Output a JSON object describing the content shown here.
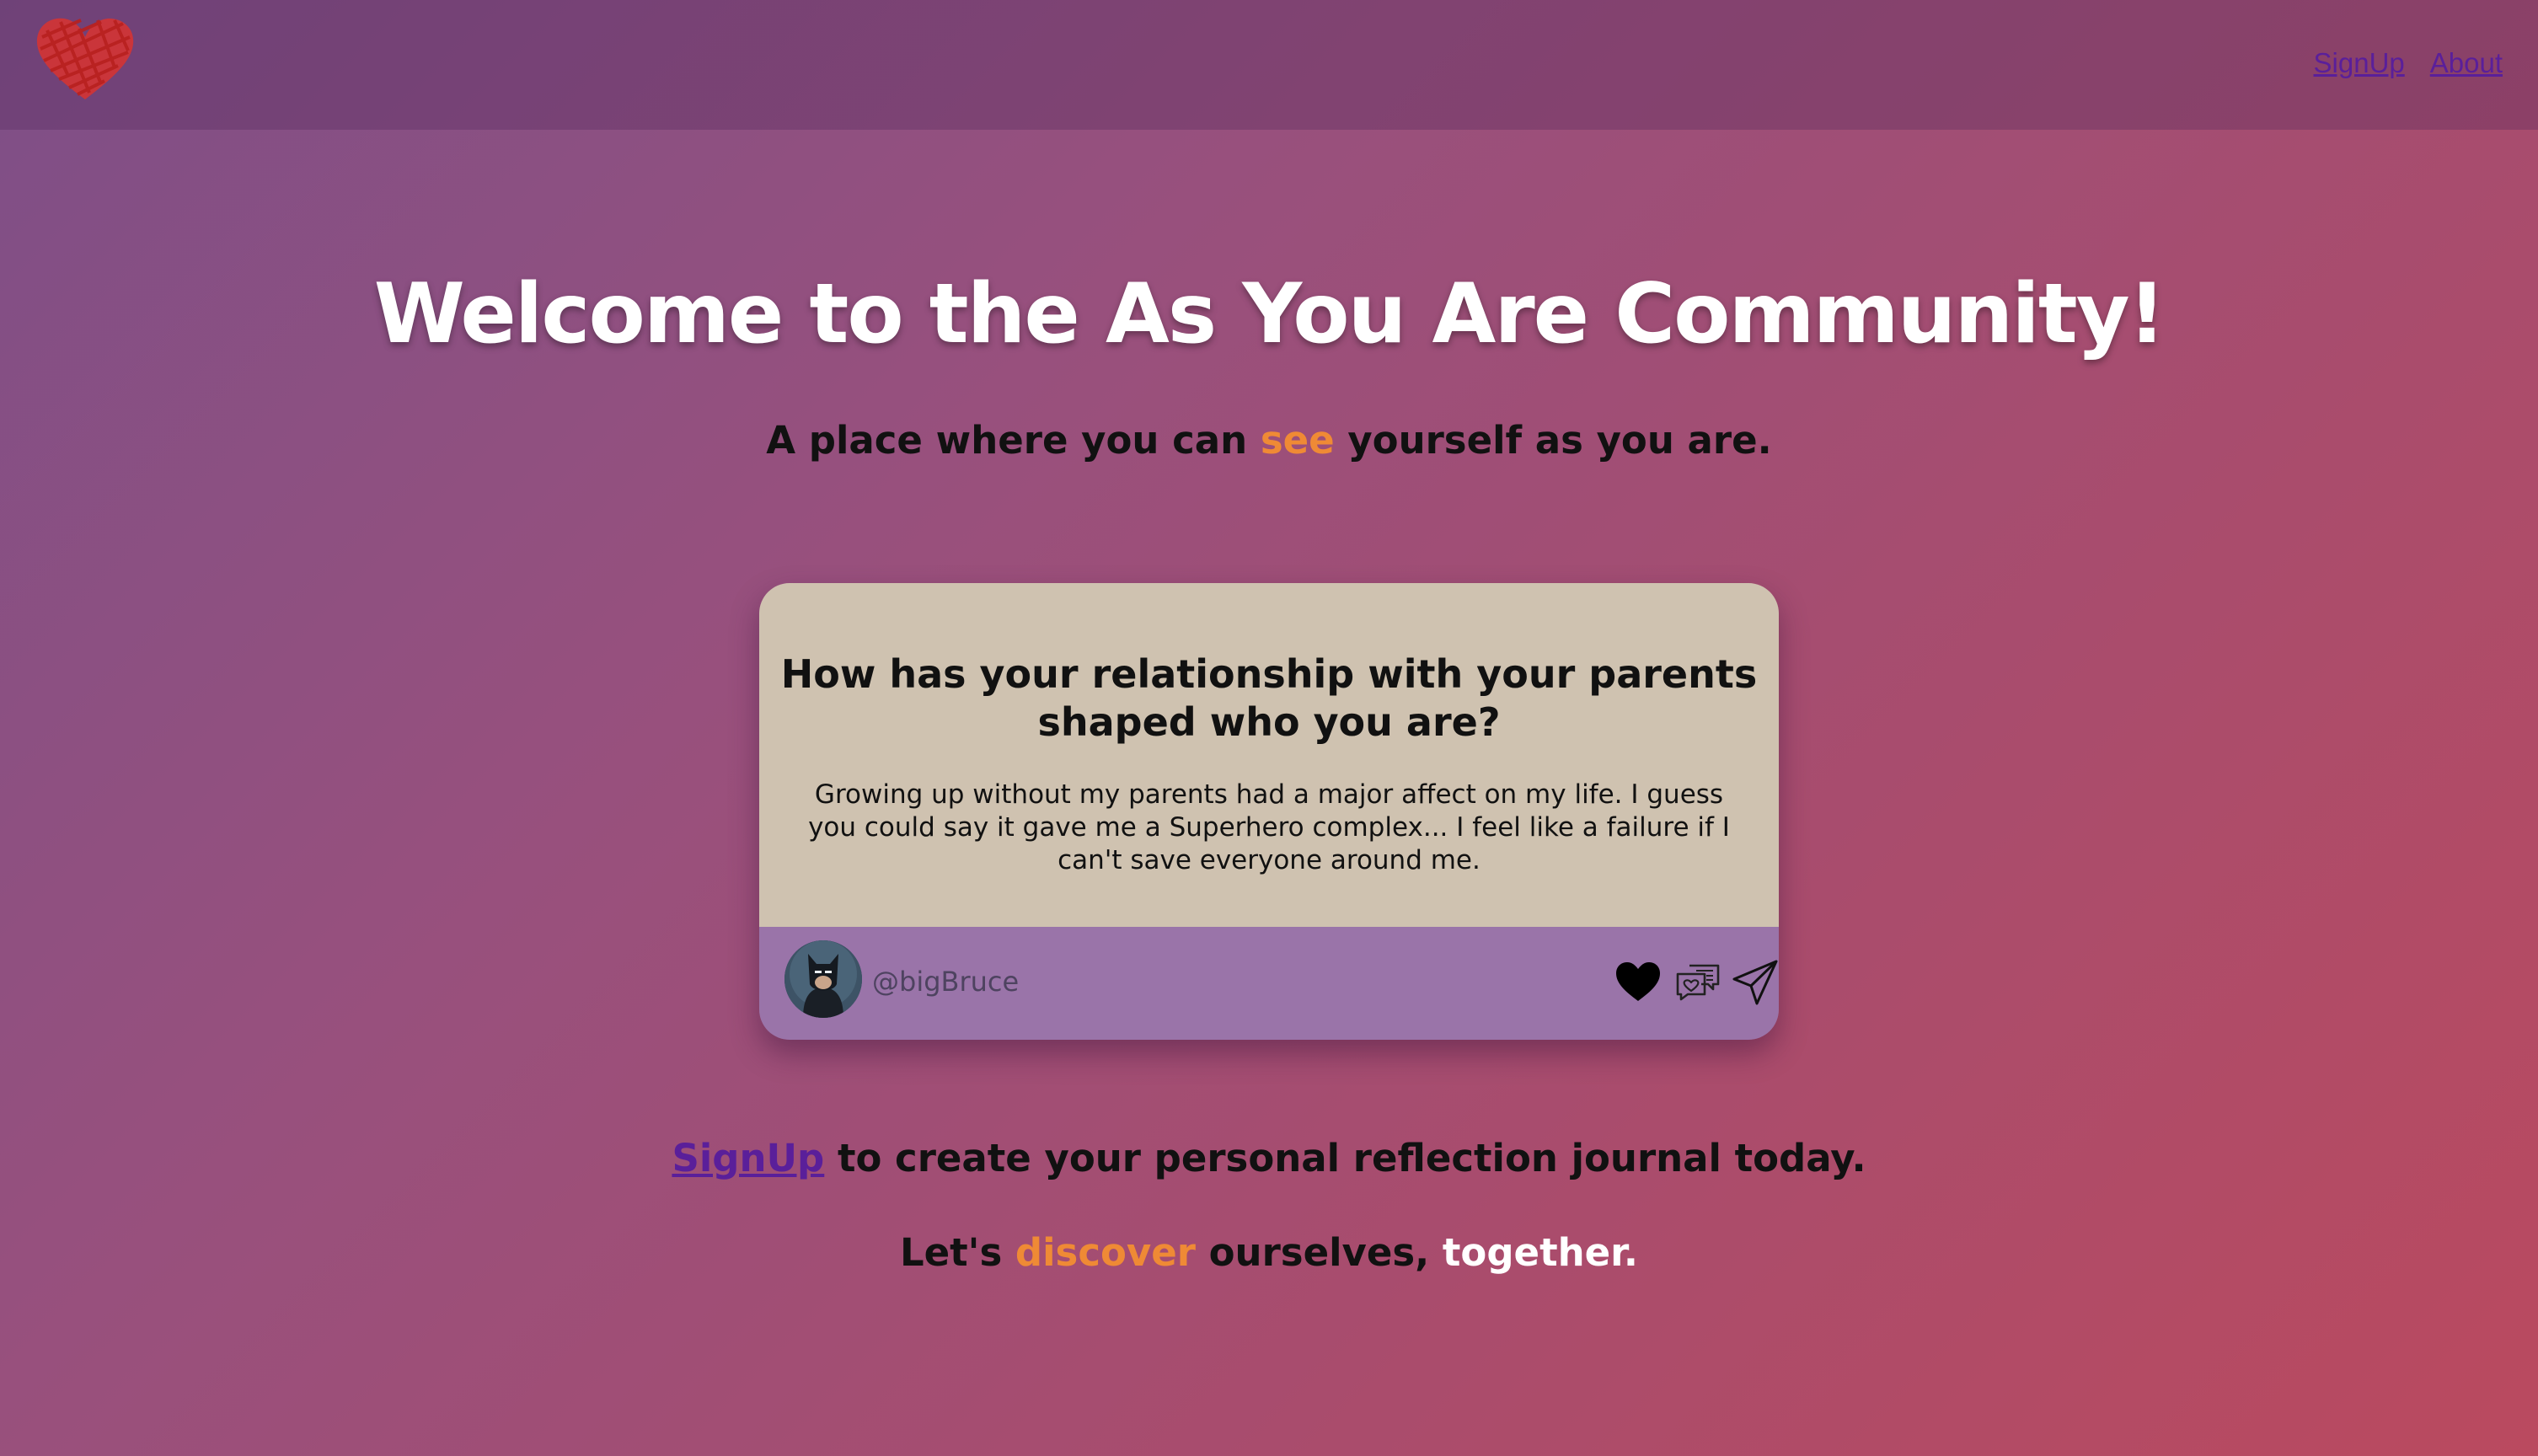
{
  "nav": {
    "logo_icon": "scribbled-heart-icon",
    "links": [
      "SignUp",
      "About"
    ]
  },
  "hero": {
    "title": "Welcome to the As You Are Community!",
    "tagline_before": "A place where you can ",
    "tagline_highlight": "see",
    "tagline_after": " yourself as you are."
  },
  "card": {
    "question": "How has your relationship with your parents shaped who you are?",
    "answer": "Growing up without my parents had a major affect on my life. I guess you could say it gave me a Superhero complex... I feel like a failure if I can't save everyone around me.",
    "username": "@bigBruce",
    "avatar_icon": "batman-avatar",
    "actions": [
      "heart-icon",
      "comments-icon",
      "share-icon"
    ]
  },
  "cta": {
    "signup_link": "SignUp",
    "signup_rest": " to create your personal reflection journal today.",
    "together_before": "Let's ",
    "together_highlight": "discover",
    "together_middle": " ourselves, ",
    "together_end": "together."
  },
  "colors": {
    "accent_orange": "#ef8a35",
    "link_purple": "#5a1f9a",
    "card_bg": "#cfc2b0",
    "card_footer": "#9a74a9",
    "logo_red": "#d9322f"
  }
}
